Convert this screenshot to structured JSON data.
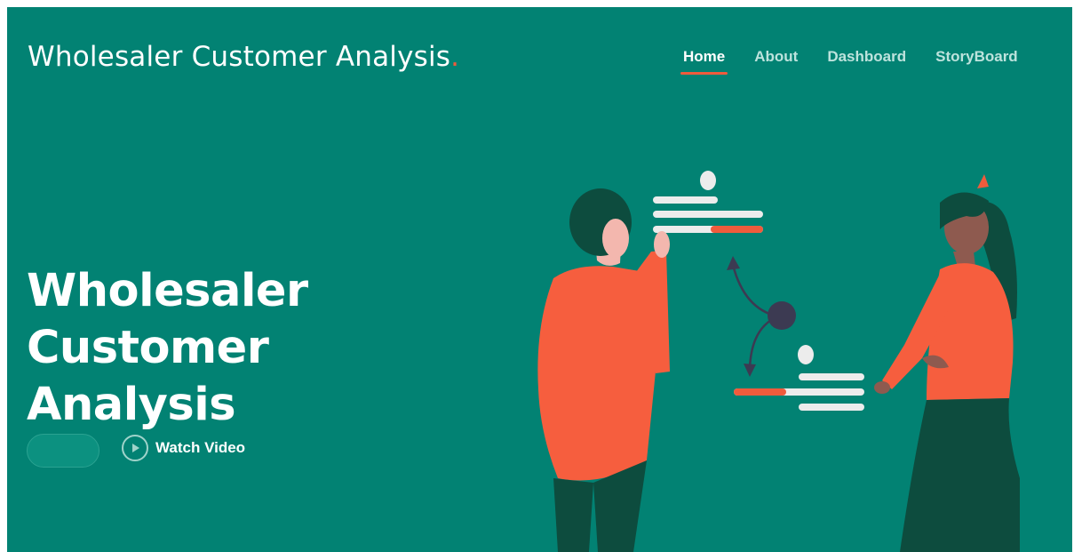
{
  "header": {
    "brand": "Wholesaler Customer Analysis",
    "brand_dot": "."
  },
  "nav": {
    "items": [
      {
        "label": "Home",
        "active": true
      },
      {
        "label": "About",
        "active": false
      },
      {
        "label": "Dashboard",
        "active": false
      },
      {
        "label": "StoryBoard",
        "active": false
      }
    ]
  },
  "hero": {
    "title_line1": "Wholesaler Customer",
    "title_line2": "Analysis",
    "watch_label": "Watch Video"
  },
  "icons": {
    "play": "play-icon"
  },
  "colors": {
    "background": "#028273",
    "accent": "#ef5b3c",
    "dark_green": "#0d4c3e",
    "text": "#ffffff"
  }
}
